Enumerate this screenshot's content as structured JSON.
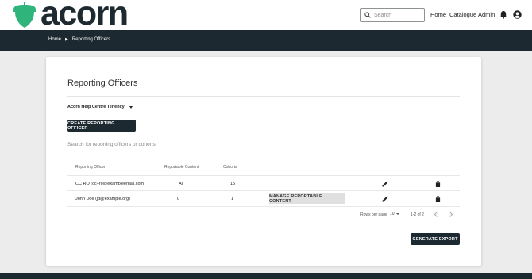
{
  "brand": {
    "name": "acorn",
    "logo_color": "#2fb57c"
  },
  "header": {
    "search": {
      "placeholder": "Search"
    },
    "nav": {
      "home": "Home",
      "catalogue": "Catalogue",
      "admin": "Admin"
    },
    "icons": {
      "search": "search-icon",
      "notifications": "bell-icon",
      "account": "account-circle-icon"
    }
  },
  "breadcrumb": {
    "items": [
      "Home",
      "Reporting Officers"
    ]
  },
  "card": {
    "title": "Reporting Officers",
    "tenancy": "Acorn Help Centre Tenency",
    "create_button": "CREATE REPORTING OFFICER",
    "search_placeholder": "Search for reporting officers or cohorts",
    "table": {
      "headers": [
        "Reporting Officer",
        "Reportable Content",
        "Cohorts"
      ],
      "rows": [
        {
          "officer": "CC RO (cc+ro@exampleemail.com)",
          "content": "All",
          "cohorts": "15",
          "action": "",
          "edit_icon": "pencil-icon",
          "delete_icon": "trash-icon"
        },
        {
          "officer": "John Doe (jd@example.org)",
          "content": "0",
          "cohorts": "1",
          "action": "MANAGE REPORTABLE CONTENT",
          "edit_icon": "pencil-icon",
          "delete_icon": "trash-icon"
        }
      ]
    },
    "pagination": {
      "rows_per_page_label": "Rows per page",
      "rows_per_page_value": "10",
      "range": "1-2 of 2"
    },
    "export_button": "GENERATE EXPORT"
  },
  "colors": {
    "dark": "#1d2930",
    "accent": "#2fb57c",
    "background": "#ececec"
  }
}
